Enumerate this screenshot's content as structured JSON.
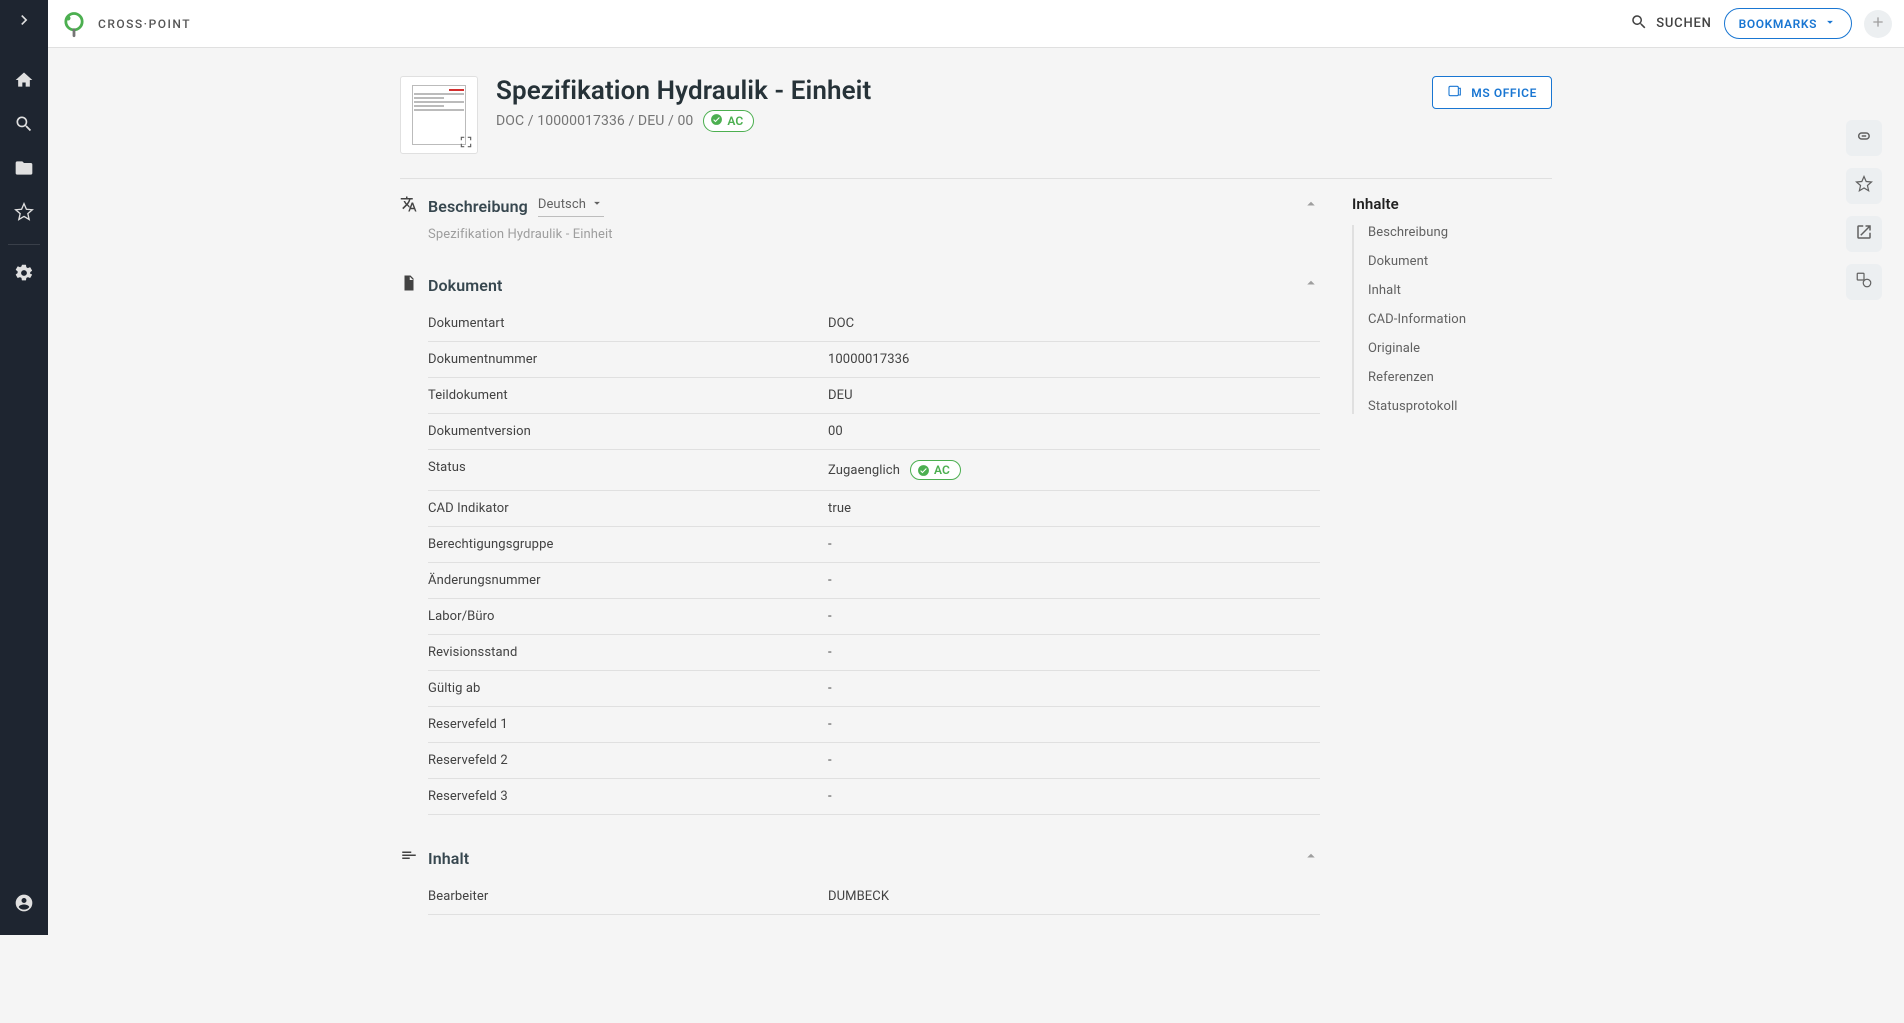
{
  "app": {
    "name": "CROSS·POINT"
  },
  "topbar": {
    "search_label": "SUCHEN",
    "bookmarks_label": "BOOKMARKS"
  },
  "document": {
    "title": "Spezifikation Hydraulik - Einheit",
    "meta_line": "DOC / 10000017336 / DEU / 00",
    "status_badge": "AC",
    "msoffice_label": "MS OFFICE"
  },
  "sections": {
    "beschreibung": {
      "title": "Beschreibung",
      "language": "Deutsch",
      "text": "Spezifikation Hydraulik - Einheit"
    },
    "dokument": {
      "title": "Dokument",
      "rows": [
        {
          "k": "Dokumentart",
          "v": "DOC"
        },
        {
          "k": "Dokumentnummer",
          "v": "10000017336"
        },
        {
          "k": "Teildokument",
          "v": "DEU"
        },
        {
          "k": "Dokumentversion",
          "v": "00"
        },
        {
          "k": "Status",
          "v": "Zugaenglich",
          "ac": true
        },
        {
          "k": "CAD Indikator",
          "v": "true"
        },
        {
          "k": "Berechtigungsgruppe",
          "v": "-"
        },
        {
          "k": "Änderungsnummer",
          "v": "-"
        },
        {
          "k": "Labor/Büro",
          "v": "-"
        },
        {
          "k": "Revisionsstand",
          "v": "-"
        },
        {
          "k": "Gültig ab",
          "v": "-"
        },
        {
          "k": "Reservefeld 1",
          "v": "-"
        },
        {
          "k": "Reservefeld 2",
          "v": "-"
        },
        {
          "k": "Reservefeld 3",
          "v": "-"
        }
      ]
    },
    "inhalt": {
      "title": "Inhalt",
      "rows": [
        {
          "k": "Bearbeiter",
          "v": "DUMBECK"
        }
      ]
    }
  },
  "toc": {
    "title": "Inhalte",
    "items": [
      "Beschreibung",
      "Dokument",
      "Inhalt",
      "CAD-Information",
      "Originale",
      "Referenzen",
      "Statusprotokoll"
    ]
  }
}
